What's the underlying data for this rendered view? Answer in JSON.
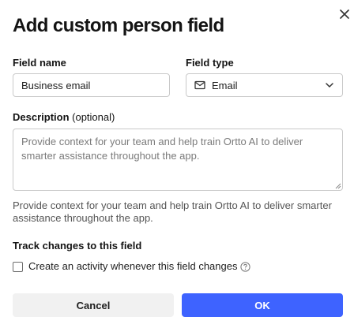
{
  "dialog": {
    "title": "Add custom person field",
    "close_icon": "close-icon"
  },
  "field_name": {
    "label": "Field name",
    "value": "Business email"
  },
  "field_type": {
    "label": "Field type",
    "value": "Email",
    "icon": "mail-icon"
  },
  "description": {
    "label": "Description",
    "optional": "(optional)",
    "placeholder": "Provide context for your team and help train Ortto AI to deliver smarter assistance throughout the app.",
    "value": ""
  },
  "help_text": "Provide context for your team and help train Ortto AI to deliver smarter assistance throughout the app.",
  "track_changes": {
    "label": "Track changes to this field",
    "checkbox_label": "Create an activity whenever this field changes",
    "checked": false
  },
  "buttons": {
    "cancel": "Cancel",
    "ok": "OK"
  },
  "colors": {
    "primary": "#3e63ff",
    "secondary_bg": "#f1f1f1",
    "border": "#c9c9c9"
  }
}
